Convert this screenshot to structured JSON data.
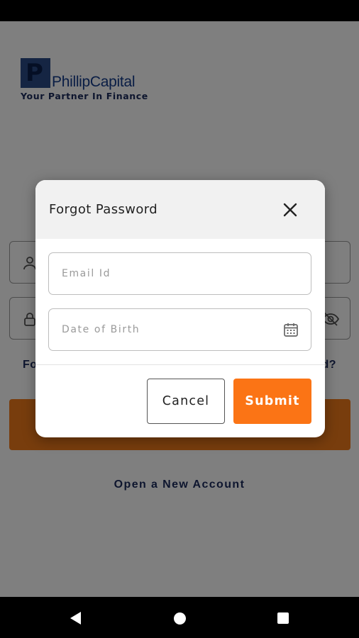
{
  "background": {
    "logo": {
      "mark_letter": "P",
      "name": "PhillipCapital",
      "tagline": "Your Partner In Finance"
    },
    "forgot_left_visible": "Fo",
    "forgot_right_visible": "d?",
    "open_account_label": "Open a New Account",
    "user_icon": "user-icon",
    "lock_icon": "lock-icon",
    "eye_icon": "eye-off-icon"
  },
  "dialog": {
    "title": "Forgot Password",
    "close_icon": "close-icon",
    "email": {
      "placeholder": "Email Id",
      "value": ""
    },
    "dob": {
      "placeholder": "Date of Birth",
      "value": "",
      "icon": "calendar-icon"
    },
    "cancel_label": "Cancel",
    "submit_label": "Submit"
  },
  "nav": {
    "back_icon": "back-icon",
    "home_icon": "home-icon",
    "recents_icon": "recents-icon"
  },
  "colors": {
    "accent": "#fb7415",
    "brand_navy": "#1b2a5c",
    "scrim": "rgba(0,0,0,0.5)"
  }
}
